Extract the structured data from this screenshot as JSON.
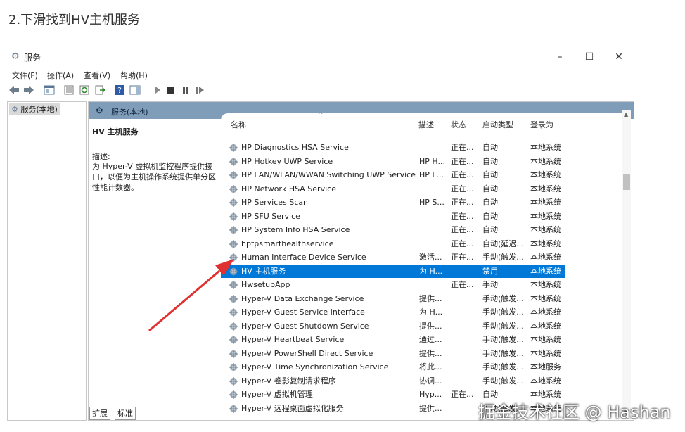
{
  "article": {
    "heading": "2.下滑找到HV主机服务"
  },
  "window": {
    "title": "服务",
    "minimize": "–",
    "maximize": "☐",
    "close": "✕"
  },
  "menu": [
    "文件(F)",
    "操作(A)",
    "查看(V)",
    "帮助(H)"
  ],
  "tree": {
    "selected": "服务(本地)"
  },
  "main": {
    "header": "服务(本地)",
    "desc_title": "HV 主机服务",
    "desc_label": "描述:",
    "desc_text": "为 Hyper-V 虚拟机监控程序提供接口，以便为主机操作系统提供单分区性能计数器。"
  },
  "columns": {
    "name": "名称",
    "desc": "描述",
    "status": "状态",
    "start": "启动类型",
    "logon": "登录为"
  },
  "services": [
    {
      "name": "HP Diagnostics HSA Service",
      "desc": "",
      "status": "正在...",
      "start": "自动",
      "logon": "本地系统"
    },
    {
      "name": "HP Hotkey UWP Service",
      "desc": "HP H...",
      "status": "正在...",
      "start": "自动",
      "logon": "本地系统"
    },
    {
      "name": "HP LAN/WLAN/WWAN Switching UWP Service",
      "desc": "HP L...",
      "status": "正在...",
      "start": "自动",
      "logon": "本地系统"
    },
    {
      "name": "HP Network HSA Service",
      "desc": "",
      "status": "正在...",
      "start": "自动",
      "logon": "本地系统"
    },
    {
      "name": "HP Services Scan",
      "desc": "HP S...",
      "status": "正在...",
      "start": "自动",
      "logon": "本地系统"
    },
    {
      "name": "HP SFU Service",
      "desc": "",
      "status": "正在...",
      "start": "自动",
      "logon": "本地系统"
    },
    {
      "name": "HP System Info HSA Service",
      "desc": "",
      "status": "正在...",
      "start": "自动",
      "logon": "本地系统"
    },
    {
      "name": "hptpsmarthealthservice",
      "desc": "",
      "status": "正在...",
      "start": "自动(延迟...",
      "logon": "本地系统"
    },
    {
      "name": "Human Interface Device Service",
      "desc": "激活...",
      "status": "正在...",
      "start": "手动(触发...",
      "logon": "本地系统"
    },
    {
      "name": "HV 主机服务",
      "desc": "为 H...",
      "status": "",
      "start": "禁用",
      "logon": "本地系统",
      "selected": true
    },
    {
      "name": "HwsetupApp",
      "desc": "",
      "status": "正在...",
      "start": "手动",
      "logon": "本地系统"
    },
    {
      "name": "Hyper-V Data Exchange Service",
      "desc": "提供...",
      "status": "",
      "start": "手动(触发...",
      "logon": "本地系统"
    },
    {
      "name": "Hyper-V Guest Service Interface",
      "desc": "为 H...",
      "status": "",
      "start": "手动(触发...",
      "logon": "本地系统"
    },
    {
      "name": "Hyper-V Guest Shutdown Service",
      "desc": "提供...",
      "status": "",
      "start": "手动(触发...",
      "logon": "本地系统"
    },
    {
      "name": "Hyper-V Heartbeat Service",
      "desc": "通过...",
      "status": "",
      "start": "手动(触发...",
      "logon": "本地系统"
    },
    {
      "name": "Hyper-V PowerShell Direct Service",
      "desc": "提供...",
      "status": "",
      "start": "手动(触发...",
      "logon": "本地系统"
    },
    {
      "name": "Hyper-V Time Synchronization Service",
      "desc": "将此...",
      "status": "",
      "start": "手动(触发...",
      "logon": "本地服务"
    },
    {
      "name": "Hyper-V 卷影复制请求程序",
      "desc": "协调...",
      "status": "",
      "start": "手动(触发...",
      "logon": "本地系统"
    },
    {
      "name": "Hyper-V 虚拟机管理",
      "desc": "Hyp...",
      "status": "正在...",
      "start": "自动",
      "logon": "本地系统"
    },
    {
      "name": "Hyper-V 远程桌面虚拟化服务",
      "desc": "提供...",
      "status": "",
      "start": "手动(触发...",
      "logon": "本地系统"
    }
  ],
  "tabs": [
    "扩展",
    "标准"
  ],
  "watermark": "掘金技术社区 @ Hashan",
  "colors": {
    "selection": "#0078d7",
    "header_bar": "#7f9db9",
    "annotation_arrow": "#e03030"
  }
}
